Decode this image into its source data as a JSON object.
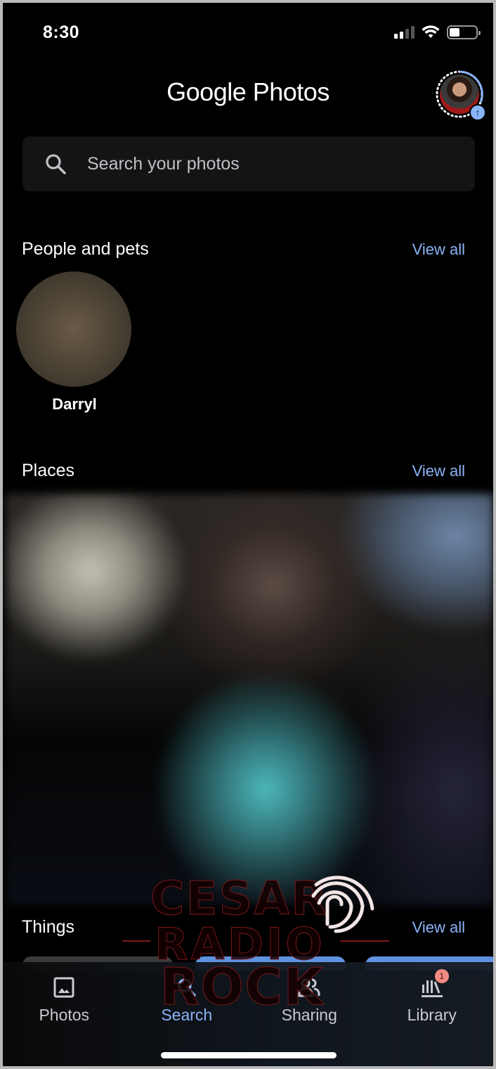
{
  "status_bar": {
    "time": "8:30",
    "signal_bars_active": 2,
    "signal_bars_total": 4,
    "wifi": "wifi-icon",
    "battery_level": 0.4
  },
  "header": {
    "title_part1": "Google",
    "title_part2": " Photos",
    "avatar": "profile-avatar",
    "upload_badge_icon": "arrow-up-icon"
  },
  "search": {
    "placeholder": "Search your photos",
    "value": "",
    "icon": "search-icon"
  },
  "sections": {
    "people": {
      "title": "People and pets",
      "view_all": "View all",
      "items": [
        {
          "name": "Darryl"
        }
      ]
    },
    "places": {
      "title": "Places",
      "view_all": "View all"
    },
    "things": {
      "title": "Things",
      "view_all": "View all"
    }
  },
  "bottom_nav": {
    "items": [
      {
        "label": "Photos",
        "icon": "photo-icon",
        "active": false
      },
      {
        "label": "Search",
        "icon": "search-icon",
        "active": true
      },
      {
        "label": "Sharing",
        "icon": "people-icon",
        "active": false
      },
      {
        "label": "Library",
        "icon": "library-icon",
        "active": false,
        "badge": "1"
      }
    ]
  },
  "watermark": {
    "line1": "Cesar",
    "line2": "Radio",
    "line3": "Rock"
  },
  "colors": {
    "accent": "#8ab4f8",
    "background": "#000000",
    "search_bg": "#141414",
    "badge": "#f28b82"
  }
}
